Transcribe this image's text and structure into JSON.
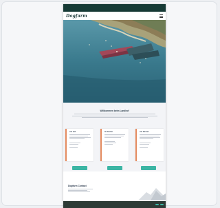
{
  "topbar": {
    "left": "",
    "right": ""
  },
  "header": {
    "logo": "Dogfarm"
  },
  "intro": {
    "title": "Willkommen beim Landhof"
  },
  "rooms": [
    {
      "title": "Am Hof",
      "button": ""
    },
    {
      "title": "Im Garten",
      "button": ""
    },
    {
      "title": "Am Strand",
      "button": ""
    }
  ],
  "contact": {
    "title": "Dogfarm Contact"
  },
  "cookie": {
    "text": "",
    "accept": "",
    "decline": ""
  },
  "colors": {
    "accent": "#3cb5a4",
    "topbar": "#163a35",
    "sea": "#2f6f85",
    "card_stripe": "#e58b5f"
  }
}
